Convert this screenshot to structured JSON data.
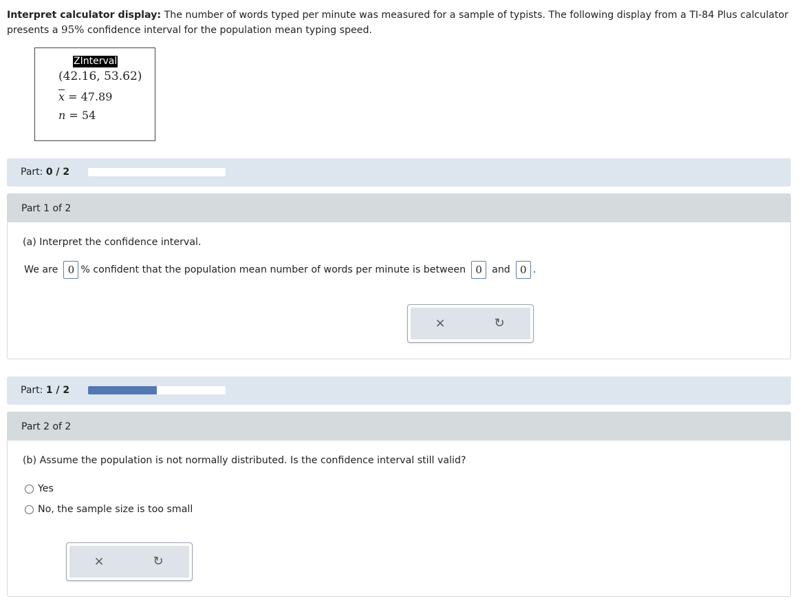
{
  "intro": {
    "bold": "Interpret calculator display:",
    "text1": " The number of words typed per minute was measured for a sample of typists. The following display from a TI-84 Plus calculator presents a ",
    "pct": "95%",
    "text2": " confidence interval for the population mean typing speed."
  },
  "calculator": {
    "title": "ZInterval",
    "interval": "(42.16, 53.62)",
    "xbar_symbol": "x",
    "xbar_value": " = 47.89",
    "n_symbol": "n",
    "n_value": " = 54"
  },
  "progress1": {
    "label": "Part: ",
    "value": "0 / 2",
    "fraction": 0.0
  },
  "part1": {
    "header": "Part 1 of 2",
    "question": "(a) Interpret the confidence interval.",
    "s1": "We are",
    "box1": "0",
    "s2": "% confident that the population mean number of words per minute is between",
    "box2": "0",
    "s3": "and",
    "box3": "0",
    "s4": "."
  },
  "progress2": {
    "label": "Part: ",
    "value": "1 / 2",
    "fraction": 0.5
  },
  "part2": {
    "header": "Part 2 of 2",
    "question": "(b) Assume the population is not normally distributed. Is the confidence interval still valid?",
    "options": [
      "Yes",
      "No, the sample size is too small"
    ]
  },
  "icons": {
    "clear": "×",
    "undo": "↻"
  },
  "colors": {
    "progress_fill": "#5178b2",
    "progress_bg": "#dde6ef",
    "part_header": "#d5dadd"
  }
}
